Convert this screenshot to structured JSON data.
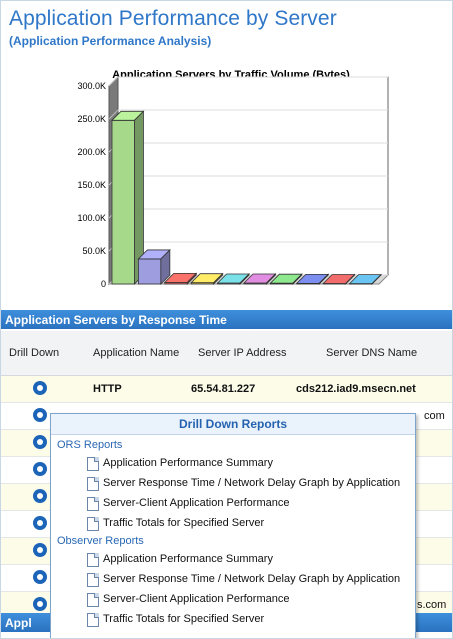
{
  "header": {
    "title": "Application Performance by Server",
    "subtitle": "(Application Performance Analysis)"
  },
  "chart_data": {
    "type": "bar",
    "title": "Application Servers by Traffic Volume (Bytes)",
    "ytick_labels": [
      "0",
      "50.0K",
      "100.0K",
      "150.0K",
      "200.0K",
      "250.0K",
      "300.0K"
    ],
    "ylim": [
      0,
      300000
    ],
    "values": [
      248000,
      38000,
      2500,
      2000,
      1500,
      1500,
      1200,
      1000,
      800,
      600
    ],
    "colors": [
      "#a6d98a",
      "#9e9de0",
      "#e0665f",
      "#f0d35c",
      "#6ec9cf",
      "#c97ec9",
      "#7fd07f",
      "#6f7fd6",
      "#d96060",
      "#5fb0d9"
    ],
    "grid": true
  },
  "section1": {
    "label": "Application Servers by Response Time"
  },
  "table": {
    "headers": [
      "Drill Down",
      "Application Name",
      "Server IP Address",
      "Server DNS Name"
    ],
    "rows": [
      {
        "app": "HTTP",
        "ip": "65.54.81.227",
        "dns": "cds212.iad9.msecn.net"
      }
    ],
    "row2_tail": "com",
    "row9_tail": "s.com"
  },
  "section2": {
    "label": "Appl"
  },
  "popup": {
    "title": "Drill Down Reports",
    "groups": [
      {
        "name": "ORS Reports",
        "items": [
          "Application Performance Summary",
          "Server Response Time / Network Delay Graph by Application",
          "Server-Client Application Performance",
          "Traffic Totals for Specified Server"
        ]
      },
      {
        "name": "Observer Reports",
        "items": [
          "Application Performance Summary",
          "Server Response Time / Network Delay Graph by Application",
          "Server-Client Application Performance",
          "Traffic Totals for Specified Server"
        ]
      }
    ]
  }
}
